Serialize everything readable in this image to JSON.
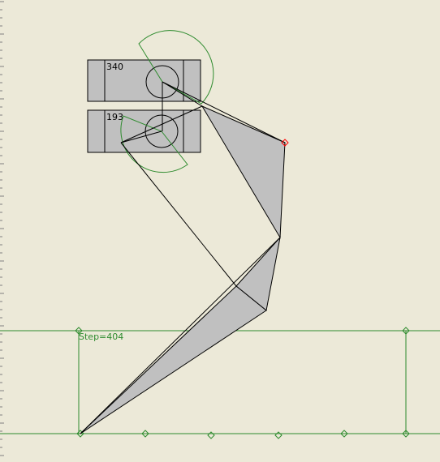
{
  "motor_top": {
    "value": "340"
  },
  "motor_bottom": {
    "value": "193"
  },
  "step": {
    "text": "Step=404"
  },
  "colors": {
    "background": "#ece9d8",
    "frame": "#2e8b2e",
    "arc": "#2e8b2e",
    "body": "#c0c0c0",
    "outline": "#000000",
    "target": "#ff0000"
  }
}
